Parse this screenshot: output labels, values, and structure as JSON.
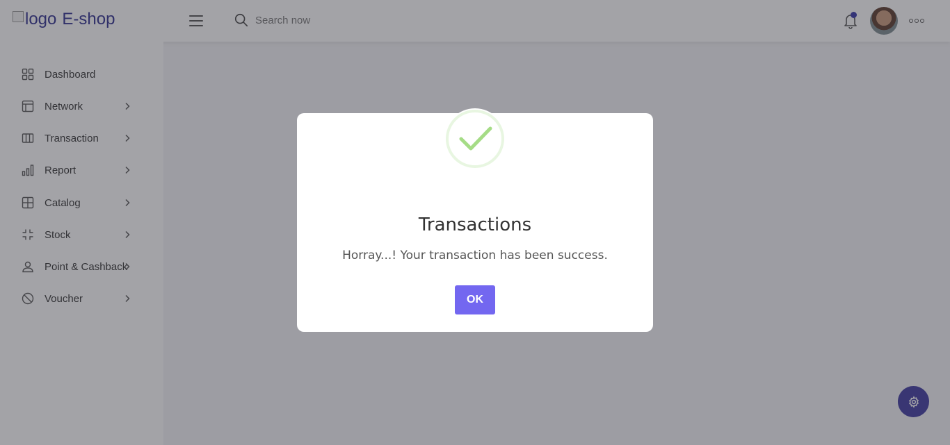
{
  "header": {
    "logo_alt": "logo",
    "brand": "E-shop",
    "search_placeholder": "Search now"
  },
  "sidebar": {
    "items": [
      {
        "label": "Dashboard",
        "icon": "grid-icon",
        "has_submenu": false
      },
      {
        "label": "Network",
        "icon": "layout-icon",
        "has_submenu": true
      },
      {
        "label": "Transaction",
        "icon": "columns-icon",
        "has_submenu": true
      },
      {
        "label": "Report",
        "icon": "bar-chart-icon",
        "has_submenu": true
      },
      {
        "label": "Catalog",
        "icon": "table-icon",
        "has_submenu": true
      },
      {
        "label": "Stock",
        "icon": "minimize-icon",
        "has_submenu": true
      },
      {
        "label": "Point & Cashback",
        "icon": "user-icon",
        "has_submenu": true
      },
      {
        "label": "Voucher",
        "icon": "slash-icon",
        "has_submenu": true
      }
    ]
  },
  "modal": {
    "icon": "success-check-icon",
    "title": "Transactions",
    "message": "Horray...! Your transaction has been success.",
    "ok_label": "OK"
  },
  "colors": {
    "brand": "#2f2f8f",
    "accent": "#7367f0",
    "success": "#a5dc86",
    "fab": "#3f3aa0"
  }
}
